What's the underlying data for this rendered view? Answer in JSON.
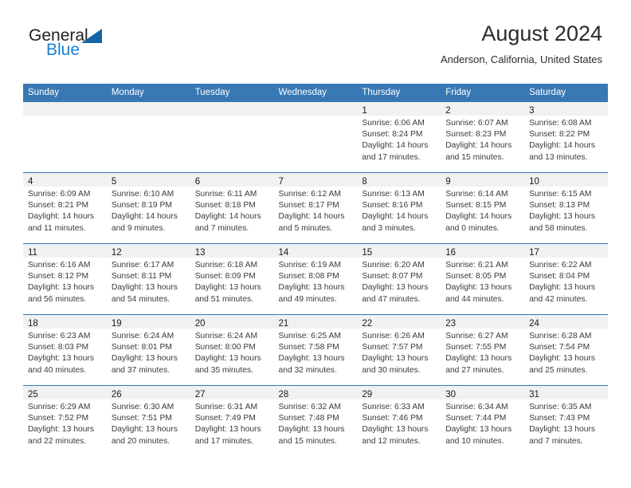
{
  "brand": {
    "name_part1": "General",
    "name_part2": "Blue",
    "accent_color": "#1a7fd4",
    "triangle_color": "#1464a5"
  },
  "header": {
    "title": "August 2024",
    "location": "Anderson, California, United States"
  },
  "calendar": {
    "header_bg": "#3878b4",
    "daynum_bg": "#f1f1f1",
    "weekdays": [
      "Sunday",
      "Monday",
      "Tuesday",
      "Wednesday",
      "Thursday",
      "Friday",
      "Saturday"
    ],
    "weeks": [
      [
        {
          "day": "",
          "sunrise": "",
          "sunset": "",
          "daylight1": "",
          "daylight2": ""
        },
        {
          "day": "",
          "sunrise": "",
          "sunset": "",
          "daylight1": "",
          "daylight2": ""
        },
        {
          "day": "",
          "sunrise": "",
          "sunset": "",
          "daylight1": "",
          "daylight2": ""
        },
        {
          "day": "",
          "sunrise": "",
          "sunset": "",
          "daylight1": "",
          "daylight2": ""
        },
        {
          "day": "1",
          "sunrise": "Sunrise: 6:06 AM",
          "sunset": "Sunset: 8:24 PM",
          "daylight1": "Daylight: 14 hours",
          "daylight2": "and 17 minutes."
        },
        {
          "day": "2",
          "sunrise": "Sunrise: 6:07 AM",
          "sunset": "Sunset: 8:23 PM",
          "daylight1": "Daylight: 14 hours",
          "daylight2": "and 15 minutes."
        },
        {
          "day": "3",
          "sunrise": "Sunrise: 6:08 AM",
          "sunset": "Sunset: 8:22 PM",
          "daylight1": "Daylight: 14 hours",
          "daylight2": "and 13 minutes."
        }
      ],
      [
        {
          "day": "4",
          "sunrise": "Sunrise: 6:09 AM",
          "sunset": "Sunset: 8:21 PM",
          "daylight1": "Daylight: 14 hours",
          "daylight2": "and 11 minutes."
        },
        {
          "day": "5",
          "sunrise": "Sunrise: 6:10 AM",
          "sunset": "Sunset: 8:19 PM",
          "daylight1": "Daylight: 14 hours",
          "daylight2": "and 9 minutes."
        },
        {
          "day": "6",
          "sunrise": "Sunrise: 6:11 AM",
          "sunset": "Sunset: 8:18 PM",
          "daylight1": "Daylight: 14 hours",
          "daylight2": "and 7 minutes."
        },
        {
          "day": "7",
          "sunrise": "Sunrise: 6:12 AM",
          "sunset": "Sunset: 8:17 PM",
          "daylight1": "Daylight: 14 hours",
          "daylight2": "and 5 minutes."
        },
        {
          "day": "8",
          "sunrise": "Sunrise: 6:13 AM",
          "sunset": "Sunset: 8:16 PM",
          "daylight1": "Daylight: 14 hours",
          "daylight2": "and 3 minutes."
        },
        {
          "day": "9",
          "sunrise": "Sunrise: 6:14 AM",
          "sunset": "Sunset: 8:15 PM",
          "daylight1": "Daylight: 14 hours",
          "daylight2": "and 0 minutes."
        },
        {
          "day": "10",
          "sunrise": "Sunrise: 6:15 AM",
          "sunset": "Sunset: 8:13 PM",
          "daylight1": "Daylight: 13 hours",
          "daylight2": "and 58 minutes."
        }
      ],
      [
        {
          "day": "11",
          "sunrise": "Sunrise: 6:16 AM",
          "sunset": "Sunset: 8:12 PM",
          "daylight1": "Daylight: 13 hours",
          "daylight2": "and 56 minutes."
        },
        {
          "day": "12",
          "sunrise": "Sunrise: 6:17 AM",
          "sunset": "Sunset: 8:11 PM",
          "daylight1": "Daylight: 13 hours",
          "daylight2": "and 54 minutes."
        },
        {
          "day": "13",
          "sunrise": "Sunrise: 6:18 AM",
          "sunset": "Sunset: 8:09 PM",
          "daylight1": "Daylight: 13 hours",
          "daylight2": "and 51 minutes."
        },
        {
          "day": "14",
          "sunrise": "Sunrise: 6:19 AM",
          "sunset": "Sunset: 8:08 PM",
          "daylight1": "Daylight: 13 hours",
          "daylight2": "and 49 minutes."
        },
        {
          "day": "15",
          "sunrise": "Sunrise: 6:20 AM",
          "sunset": "Sunset: 8:07 PM",
          "daylight1": "Daylight: 13 hours",
          "daylight2": "and 47 minutes."
        },
        {
          "day": "16",
          "sunrise": "Sunrise: 6:21 AM",
          "sunset": "Sunset: 8:05 PM",
          "daylight1": "Daylight: 13 hours",
          "daylight2": "and 44 minutes."
        },
        {
          "day": "17",
          "sunrise": "Sunrise: 6:22 AM",
          "sunset": "Sunset: 8:04 PM",
          "daylight1": "Daylight: 13 hours",
          "daylight2": "and 42 minutes."
        }
      ],
      [
        {
          "day": "18",
          "sunrise": "Sunrise: 6:23 AM",
          "sunset": "Sunset: 8:03 PM",
          "daylight1": "Daylight: 13 hours",
          "daylight2": "and 40 minutes."
        },
        {
          "day": "19",
          "sunrise": "Sunrise: 6:24 AM",
          "sunset": "Sunset: 8:01 PM",
          "daylight1": "Daylight: 13 hours",
          "daylight2": "and 37 minutes."
        },
        {
          "day": "20",
          "sunrise": "Sunrise: 6:24 AM",
          "sunset": "Sunset: 8:00 PM",
          "daylight1": "Daylight: 13 hours",
          "daylight2": "and 35 minutes."
        },
        {
          "day": "21",
          "sunrise": "Sunrise: 6:25 AM",
          "sunset": "Sunset: 7:58 PM",
          "daylight1": "Daylight: 13 hours",
          "daylight2": "and 32 minutes."
        },
        {
          "day": "22",
          "sunrise": "Sunrise: 6:26 AM",
          "sunset": "Sunset: 7:57 PM",
          "daylight1": "Daylight: 13 hours",
          "daylight2": "and 30 minutes."
        },
        {
          "day": "23",
          "sunrise": "Sunrise: 6:27 AM",
          "sunset": "Sunset: 7:55 PM",
          "daylight1": "Daylight: 13 hours",
          "daylight2": "and 27 minutes."
        },
        {
          "day": "24",
          "sunrise": "Sunrise: 6:28 AM",
          "sunset": "Sunset: 7:54 PM",
          "daylight1": "Daylight: 13 hours",
          "daylight2": "and 25 minutes."
        }
      ],
      [
        {
          "day": "25",
          "sunrise": "Sunrise: 6:29 AM",
          "sunset": "Sunset: 7:52 PM",
          "daylight1": "Daylight: 13 hours",
          "daylight2": "and 22 minutes."
        },
        {
          "day": "26",
          "sunrise": "Sunrise: 6:30 AM",
          "sunset": "Sunset: 7:51 PM",
          "daylight1": "Daylight: 13 hours",
          "daylight2": "and 20 minutes."
        },
        {
          "day": "27",
          "sunrise": "Sunrise: 6:31 AM",
          "sunset": "Sunset: 7:49 PM",
          "daylight1": "Daylight: 13 hours",
          "daylight2": "and 17 minutes."
        },
        {
          "day": "28",
          "sunrise": "Sunrise: 6:32 AM",
          "sunset": "Sunset: 7:48 PM",
          "daylight1": "Daylight: 13 hours",
          "daylight2": "and 15 minutes."
        },
        {
          "day": "29",
          "sunrise": "Sunrise: 6:33 AM",
          "sunset": "Sunset: 7:46 PM",
          "daylight1": "Daylight: 13 hours",
          "daylight2": "and 12 minutes."
        },
        {
          "day": "30",
          "sunrise": "Sunrise: 6:34 AM",
          "sunset": "Sunset: 7:44 PM",
          "daylight1": "Daylight: 13 hours",
          "daylight2": "and 10 minutes."
        },
        {
          "day": "31",
          "sunrise": "Sunrise: 6:35 AM",
          "sunset": "Sunset: 7:43 PM",
          "daylight1": "Daylight: 13 hours",
          "daylight2": "and 7 minutes."
        }
      ]
    ]
  }
}
